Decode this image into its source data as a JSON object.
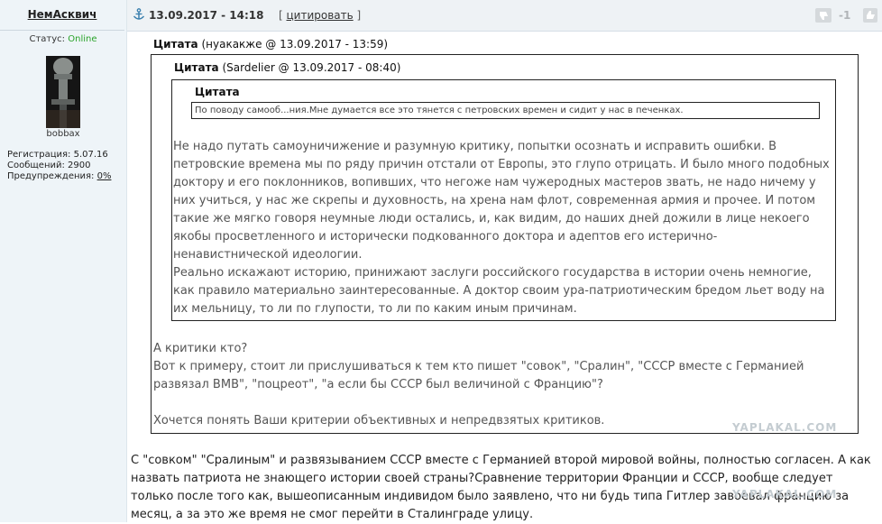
{
  "author": {
    "name": "НемАсквич",
    "status_label": "Статус:",
    "status_value": "Online",
    "avatar_caption": "bobbax",
    "stats": {
      "registration": "Регистрация: 5.07.16",
      "messages": "Сообщений: 2900",
      "warnings_label": "Предупреждения: ",
      "warnings_value": "0%"
    }
  },
  "header": {
    "date": "13.09.2017 - 14:18",
    "quote_open": "[ ",
    "quote_label": "цитировать",
    "quote_close": " ]",
    "rating": "-1"
  },
  "quotes": {
    "q1": {
      "title": "Цитата",
      "meta": " (нуакакже @ 13.09.2017 - 13:59)",
      "line1": "А критики кто?",
      "line2": "Вот к примеру, стоит ли прислушиваться к тем кто пишет \"совок\", \"Сралин\", \"СССР вместе с Германией развязал ВМВ\", \"поцреот\", \"а если бы СССР был величиной с Францию\"?",
      "line3": "Хочется понять Ваши критерии объективных и непредвзятых критиков."
    },
    "q2": {
      "title": "Цитата",
      "meta": " (Sardelier @ 13.09.2017 - 08:40)",
      "para1": "Не надо путать самоуничижение и разумную критику, попытки осознать и исправить ошибки. В петровские времена мы по ряду причин отстали от Европы, это глупо отрицать. И было много подобных доктору и его поклонников, вопивших, что негоже нам чужеродных мастеров звать, не надо ничему у них учиться, у нас же скрепы и духовность, на хрена нам флот, современная армия и прочее. И потом такие же мягко говоря неумные люди остались, и, как видим, до наших дней дожили в лице некоего якобы просветленного и исторически подкованного доктора и адептов его истерично-ненавистнической идеологии.",
      "para2": "Реально искажают историю, принижают заслуги российского государства в истории очень немногие, как правило материально заинтересованные. А доктор своим ура-патриотическим бредом льет воду на их мельницу, то ли по глупости, то ли по каким иным причинам."
    },
    "q3": {
      "title": "Цитата",
      "text": "По поводу самооб...ния.Мне думается все это тянется с петровских времен и сидит у нас в печенках."
    }
  },
  "reply": "С \"совком\" \"Сралиным\" и развязыванием СССР вместе с Германией второй мировой войны, полностью согласен. А как назвать патриота не знающего истории своей страны?Сравнение территории Франции и СССР, вообще следует только после того как, вышеописанным индивидом было заявлено, что ни будь типа Гитлер завоевал францию за месяц, а за это же время не смог перейти в Сталинграде улицу.",
  "watermark": "YAPLAKAL.COM",
  "colors": {
    "online": "#2aa32a",
    "sidebar": "#eef4f8",
    "header": "#eef2f5"
  }
}
